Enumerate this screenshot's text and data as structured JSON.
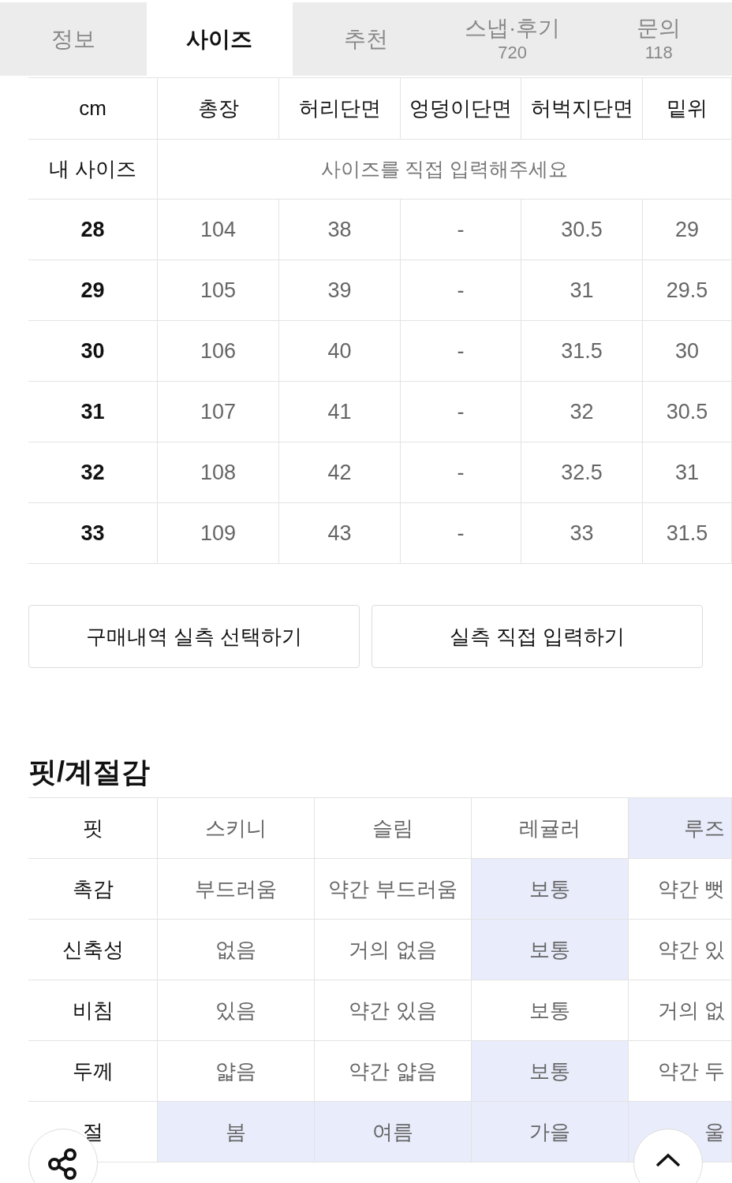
{
  "tabs": [
    {
      "label": "정보",
      "selected": false
    },
    {
      "label": "사이즈",
      "selected": true
    },
    {
      "label": "추천",
      "selected": false
    },
    {
      "label": "스냅·후기",
      "count": "720",
      "selected": false
    },
    {
      "label": "문의",
      "count": "118",
      "selected": false
    }
  ],
  "size_table": {
    "columns": [
      "cm",
      "총장",
      "허리단면",
      "엉덩이단면",
      "허벅지단면",
      "밑위"
    ],
    "my_size": {
      "label": "내 사이즈",
      "prompt": "사이즈를 직접 입력해주세요"
    },
    "rows": [
      [
        "28",
        "104",
        "38",
        "-",
        "30.5",
        "29"
      ],
      [
        "29",
        "105",
        "39",
        "-",
        "31",
        "29.5"
      ],
      [
        "30",
        "106",
        "40",
        "-",
        "31.5",
        "30"
      ],
      [
        "31",
        "107",
        "41",
        "-",
        "32",
        "30.5"
      ],
      [
        "32",
        "108",
        "42",
        "-",
        "32.5",
        "31"
      ],
      [
        "33",
        "109",
        "43",
        "-",
        "33",
        "31.5"
      ]
    ]
  },
  "buttons": [
    "구매내역 실측 선택하기",
    "실측 직접 입력하기"
  ],
  "fit_section": {
    "title": "핏/계절감",
    "rows": [
      {
        "label": "핏",
        "options": [
          {
            "label": "스키니",
            "selected": false
          },
          {
            "label": "슬림",
            "selected": false
          },
          {
            "label": "레귤러",
            "selected": false
          },
          {
            "label": "루즈",
            "selected": true
          }
        ]
      },
      {
        "label": "촉감",
        "options": [
          {
            "label": "부드러움",
            "selected": false
          },
          {
            "label": "약간 부드러움",
            "selected": false
          },
          {
            "label": "보통",
            "selected": true
          },
          {
            "label": "약간 뻣",
            "selected": false
          }
        ]
      },
      {
        "label": "신축성",
        "options": [
          {
            "label": "없음",
            "selected": false
          },
          {
            "label": "거의 없음",
            "selected": false
          },
          {
            "label": "보통",
            "selected": true
          },
          {
            "label": "약간 있",
            "selected": false
          }
        ]
      },
      {
        "label": "비침",
        "options": [
          {
            "label": "있음",
            "selected": false
          },
          {
            "label": "약간 있음",
            "selected": false
          },
          {
            "label": "보통",
            "selected": false
          },
          {
            "label": "거의 없",
            "selected": false
          }
        ]
      },
      {
        "label": "두께",
        "options": [
          {
            "label": "얇음",
            "selected": false
          },
          {
            "label": "약간 얇음",
            "selected": false
          },
          {
            "label": "보통",
            "selected": true
          },
          {
            "label": "약간 두",
            "selected": false
          }
        ]
      },
      {
        "label": "절",
        "options": [
          {
            "label": "봄",
            "selected": true
          },
          {
            "label": "여름",
            "selected": true
          },
          {
            "label": "가을",
            "selected": true
          },
          {
            "label": "울",
            "selected": true
          }
        ]
      }
    ]
  }
}
